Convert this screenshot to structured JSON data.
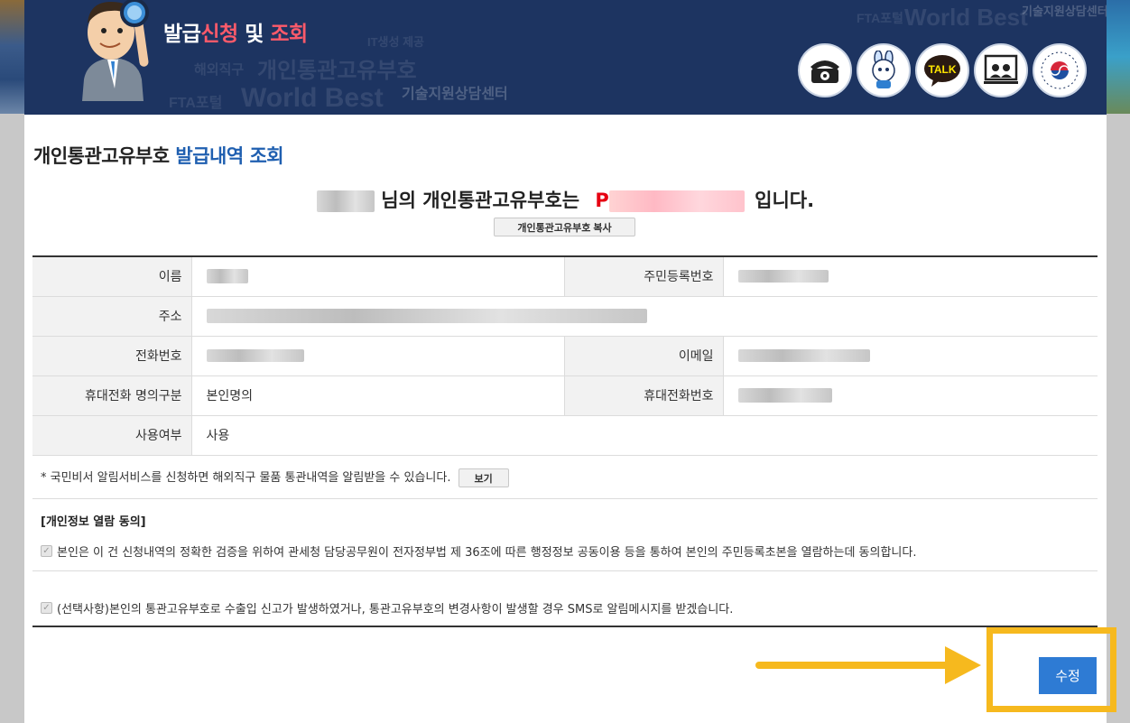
{
  "header": {
    "title_part1": "발급",
    "title_part2": "신청",
    "title_part3": " 및 ",
    "title_part4": "조회",
    "icons": [
      "phone-icon",
      "mascot-chat-icon",
      "kakao-talk-icon",
      "video-consult-icon",
      "government-emblem-icon"
    ],
    "kakao_label": "TALK",
    "bg_words": [
      "World Best",
      "개인통관고유부호",
      "FTA포털",
      "기술지원상담센터",
      "해외직구",
      "World Best",
      "FTA포털",
      "IT생성 제공",
      "기술지원상담센터"
    ]
  },
  "page": {
    "title_main": "개인통관고유부호",
    "title_sub": "발급내역 조회",
    "message_mid": "님의 개인통관고유부호는",
    "code_prefix": "P",
    "message_end": "입니다.",
    "copy_button": "개인통관고유부호 복사"
  },
  "info": {
    "name_label": "이름",
    "rrn_label": "주민등록번호",
    "address_label": "주소",
    "phone_label": "전화번호",
    "email_label": "이메일",
    "mobile_type_label": "휴대전화 명의구분",
    "mobile_type_value": "본인명의",
    "mobile_label": "휴대전화번호",
    "usage_label": "사용여부",
    "usage_value": "사용"
  },
  "notice": {
    "text": "* 국민비서 알림서비스를 신청하면 해외직구 물품 통관내역을 알림받을 수 있습니다.",
    "view_button": "보기"
  },
  "consent": {
    "title": "[개인정보 열람 동의]",
    "item1": "본인은 이 건 신청내역의 정확한 검증을 위하여 관세청 담당공무원이 전자정부법 제 36조에 따른 행정정보 공동이용 등을 통하여 본인의 주민등록초본을 열람하는데 동의합니다.",
    "item2": "(선택사항)본인의 통관고유부호로 수출입 신고가 발생하였거나, 통관고유부호의 변경사항이 발생할 경우 SMS로 알림메시지를 받겠습니다."
  },
  "actions": {
    "edit_button": "수정"
  },
  "colors": {
    "header_bg": "#1d3461",
    "title_highlight": "#ff5a6a",
    "link_blue": "#1f5fb0",
    "code_red": "#e60012",
    "button_blue": "#2e7bd4",
    "annotation_yellow": "#f6b91e"
  }
}
